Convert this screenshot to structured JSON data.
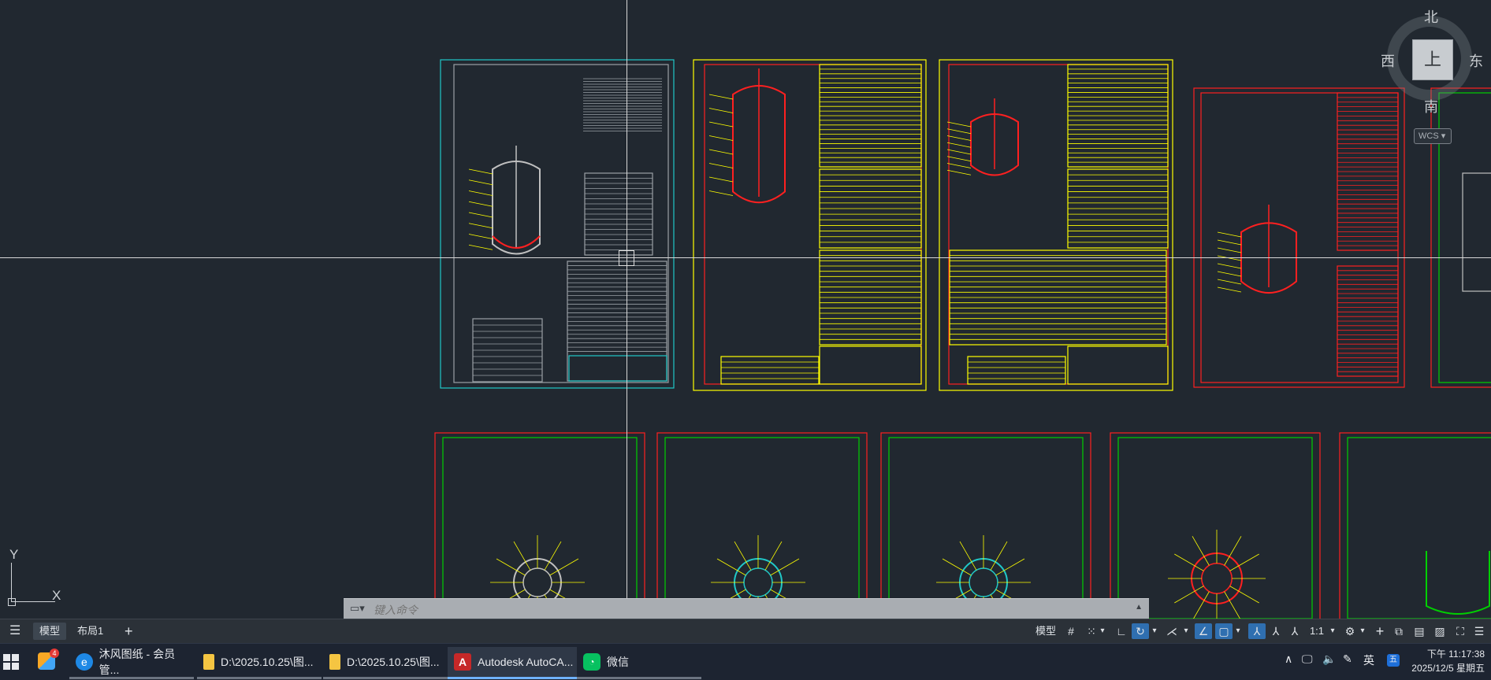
{
  "compass": {
    "north": "北",
    "south": "南",
    "west": "西",
    "east": "东",
    "top_face": "上",
    "wcs": "WCS"
  },
  "ucs": {
    "x": "X",
    "y": "Y"
  },
  "command": {
    "placeholder": "键入命令",
    "close": "✕",
    "settings": "🔧",
    "expand": "▲"
  },
  "layout_tabs": {
    "menu": "☰",
    "model": "模型",
    "layout1": "布局1",
    "add": "+"
  },
  "status": {
    "model_label": "模型",
    "scale": "1:1"
  },
  "taskbar": {
    "items": [
      {
        "label": "沐风图纸 - 会员管..."
      },
      {
        "label": "D:\\2025.10.25\\图..."
      },
      {
        "label": "D:\\2025.10.25\\图..."
      },
      {
        "label": "Autodesk AutoCA..."
      },
      {
        "label": "微信"
      }
    ],
    "badge": "4",
    "ime": "英",
    "time": "下午 11:17:38",
    "date": "2025/12/5 星期五"
  },
  "colors": {
    "canvas": "#212830",
    "yellow": "#ffff00",
    "red": "#ff2020",
    "green": "#00d000",
    "cyan": "#20c8c8"
  }
}
